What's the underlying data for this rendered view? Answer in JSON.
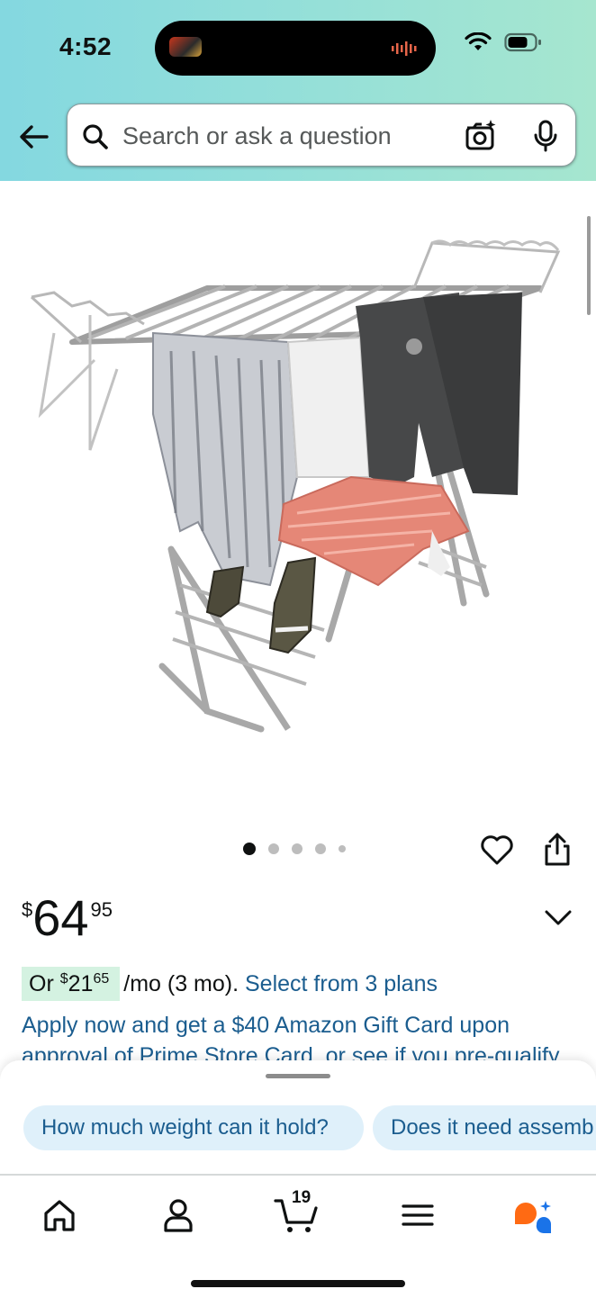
{
  "status_bar": {
    "time": "4:52"
  },
  "search": {
    "placeholder": "Search or ask a question"
  },
  "product": {
    "price_symbol": "$",
    "price_dollars": "64",
    "price_cents": "95",
    "image_dots": 5,
    "active_dot": 0
  },
  "installment": {
    "prefix": "Or",
    "amount_symbol": "$",
    "amount_dollars": "21",
    "amount_cents": "65",
    "term": "/mo (3 mo).",
    "plans_link": "Select from 3 plans"
  },
  "promo": {
    "line1": "Apply now and get a $40 Amazon Gift Card upon",
    "line2": "approval of Prime Store Card, or see if you pre-qualify"
  },
  "suggestions": [
    "How much weight can it hold?",
    "Does it need assemb"
  ],
  "nav": {
    "cart_count": "19"
  },
  "colors": {
    "accent_link": "#1b5d8f",
    "chip_bg": "#dff0fa",
    "badge_bg": "#d4f2e1",
    "rufus_orange": "#ff6a13",
    "rufus_blue": "#1a73e8"
  }
}
